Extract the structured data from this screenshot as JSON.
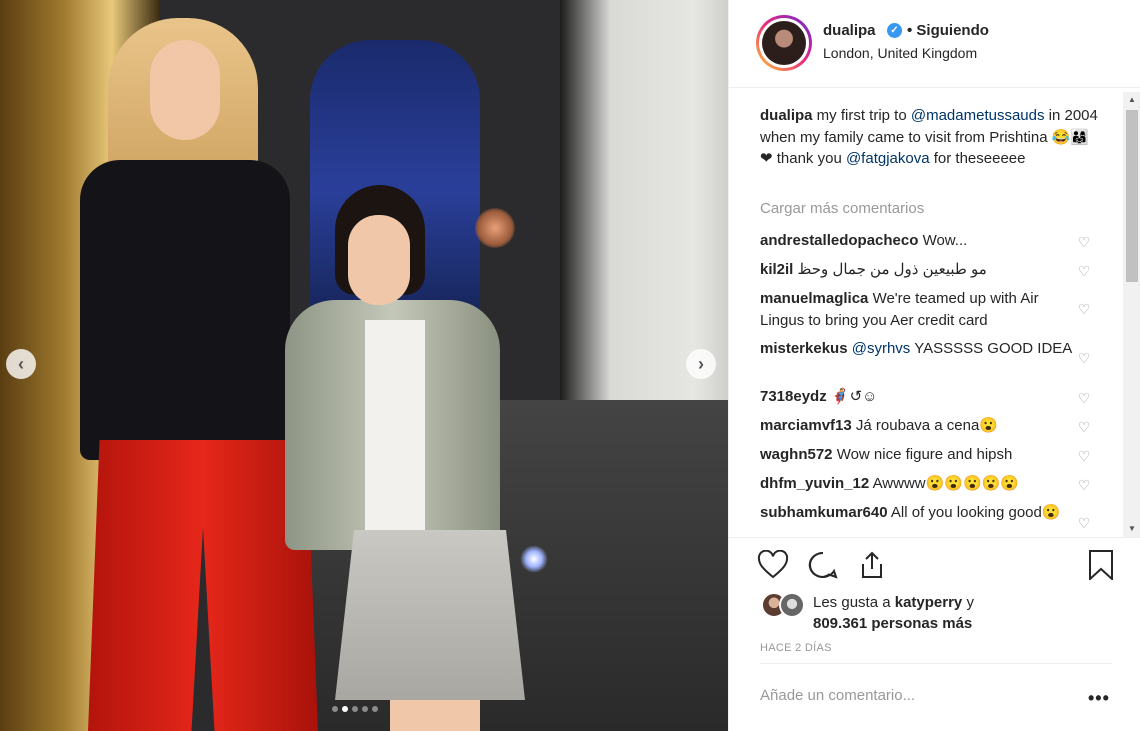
{
  "post": {
    "carousel": {
      "slide_count": 5,
      "active_slide": 2,
      "prev_glyph": "‹",
      "next_glyph": "›"
    }
  },
  "header": {
    "username": "dualipa",
    "verified_glyph": "✓",
    "follow_status": "• Siguiendo",
    "location": "London, United Kingdom"
  },
  "caption": {
    "username": "dualipa",
    "text_1": " my first trip to ",
    "mention_1": "@madametussauds",
    "text_2": " in 2004 when my family came to visit from Prishtina 😂👨‍👩‍👧❤ thank you ",
    "mention_2": "@fatgjakova",
    "text_3": " for theseeeee"
  },
  "load_more": "Cargar más comentarios",
  "comments": [
    {
      "user": "andrestalledopacheco",
      "pre": "",
      "mention": "",
      "text": "Wow..."
    },
    {
      "user": "kil2il",
      "pre": "",
      "mention": "",
      "text": "مو طبيعين ذول من جمال وحظ"
    },
    {
      "user": "manuelmaglica",
      "pre": "",
      "mention": "",
      "text": "We're teamed up with Air Lingus to bring you Aer credit card"
    },
    {
      "user": "misterkekus",
      "pre": "",
      "mention": "@syrhvs",
      "text": " YASSSSS GOOD IDEA"
    },
    {
      "user": "7318eydz",
      "pre": "",
      "mention": "",
      "text": "🦸‍♂️↺☺"
    },
    {
      "user": "marciamvf13",
      "pre": "",
      "mention": "",
      "text": "Já roubava a cena😮"
    },
    {
      "user": "waghn572",
      "pre": "",
      "mention": "",
      "text": "Wow nice figure and hipsh"
    },
    {
      "user": "dhfm_yuvin_12",
      "pre": "",
      "mention": "",
      "text": "Awwww😮😮😮😮😮"
    },
    {
      "user": "subhamkumar640",
      "pre": "",
      "mention": "",
      "text": "All of you looking good😮"
    }
  ],
  "likes": {
    "prefix": "Les gusta a ",
    "user": "katyperry",
    "mid": " y",
    "count": "809.361 personas más"
  },
  "time_ago": "HACE 2 DÍAS",
  "add_comment": {
    "placeholder": "Añade un comentario..."
  },
  "more_glyph": "•••",
  "colors": {
    "mention": "#003569",
    "verified": "#3897f0",
    "muted": "#999999"
  }
}
